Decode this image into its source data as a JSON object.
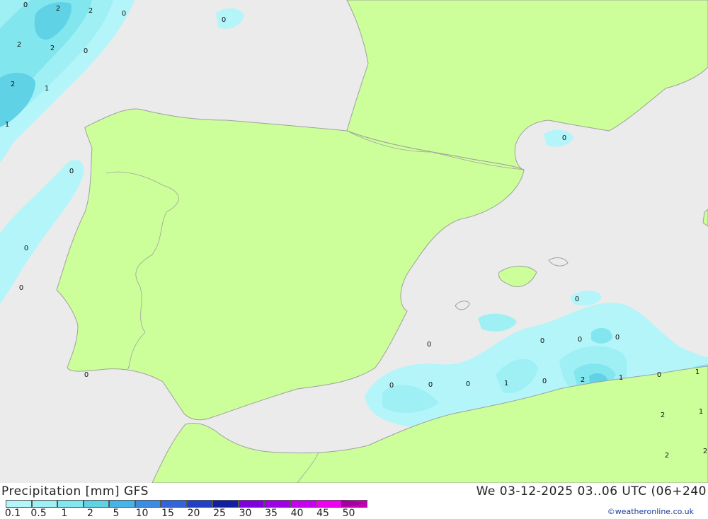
{
  "header": {
    "title": "Precipitation [mm] GFS",
    "datetime": "We 03-12-2025 03..06 UTC (06+240",
    "credit": "©weatheronline.co.uk"
  },
  "legend": {
    "ticks": [
      "0.1",
      "0.5",
      "1",
      "2",
      "5",
      "10",
      "15",
      "20",
      "25",
      "30",
      "35",
      "40",
      "45",
      "50"
    ],
    "colors": [
      "#b4f5fa",
      "#9ff0f5",
      "#82e6ee",
      "#5fd2e6",
      "#46b4e6",
      "#3c8ce6",
      "#3264dc",
      "#2040c8",
      "#1020a0",
      "#8000e0",
      "#a000e8",
      "#c800f0",
      "#f000f0",
      "#c800b4"
    ],
    "arrow_color": "#a000a0"
  },
  "map": {
    "land_color": "#ccff99",
    "sea_color": "#ebebeb",
    "border_color": "#a0a0a0",
    "labels": [
      "0",
      "2",
      "2",
      "0",
      "0",
      "2",
      "2",
      "0",
      "2",
      "1",
      "1",
      "0",
      "0",
      "0",
      "0",
      "0",
      "0",
      "0",
      "0",
      "0",
      "0",
      "0",
      "0",
      "0",
      "1",
      "0",
      "2",
      "1",
      "0",
      "1",
      "2",
      "1",
      "2",
      "2"
    ]
  }
}
